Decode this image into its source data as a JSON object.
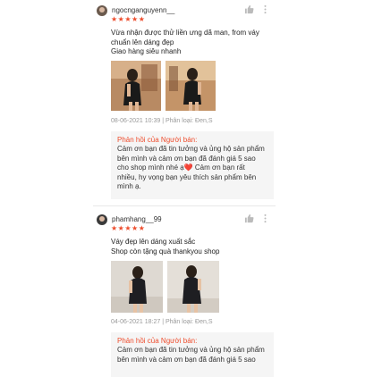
{
  "reviews": [
    {
      "username": "ngocnganguyenn__",
      "stars": "★★★★★",
      "comment_lines": [
        "Vừa nhận được thử liền ưng dã man, from váy",
        "chuẩn lên dáng đẹp",
        "Giao hàng siêu nhanh"
      ],
      "meta": "08-06-2021 10:39 | Phân loại: Đen,S",
      "reply_title": "Phản hồi của Người bán:",
      "reply_lines": [
        "Cảm ơn bạn đã tin tưởng và ủng hộ sản phẩm",
        "bên mình và cảm ơn bạn đã đánh giá 5 sao",
        "cho shop mình nhé ạ❤️ Cảm ơn bạn rất",
        "nhiều, hy vọng bạn yêu thích sản phẩm bên",
        "mình ạ."
      ]
    },
    {
      "username": "phamhang__99",
      "stars": "★★★★★",
      "comment_lines": [
        "Váy đẹp lên dáng xuất sắc",
        "Shop còn tặng quà thankyou shop"
      ],
      "meta": "04-06-2021 18:27 | Phân loại: Đen,S",
      "reply_title": "Phản hồi của Người bán:",
      "reply_lines": [
        "Cảm ơn bạn đã tin tưởng và ủng hộ sản phẩm",
        "bên mình và cảm ơn bạn đã đánh giá 5 sao"
      ]
    }
  ],
  "icons": {
    "like": "thumbs-up-icon",
    "more": "more-vertical-icon"
  },
  "colors": {
    "accent": "#ee4d2d",
    "reply_bg": "#f5f5f5"
  }
}
